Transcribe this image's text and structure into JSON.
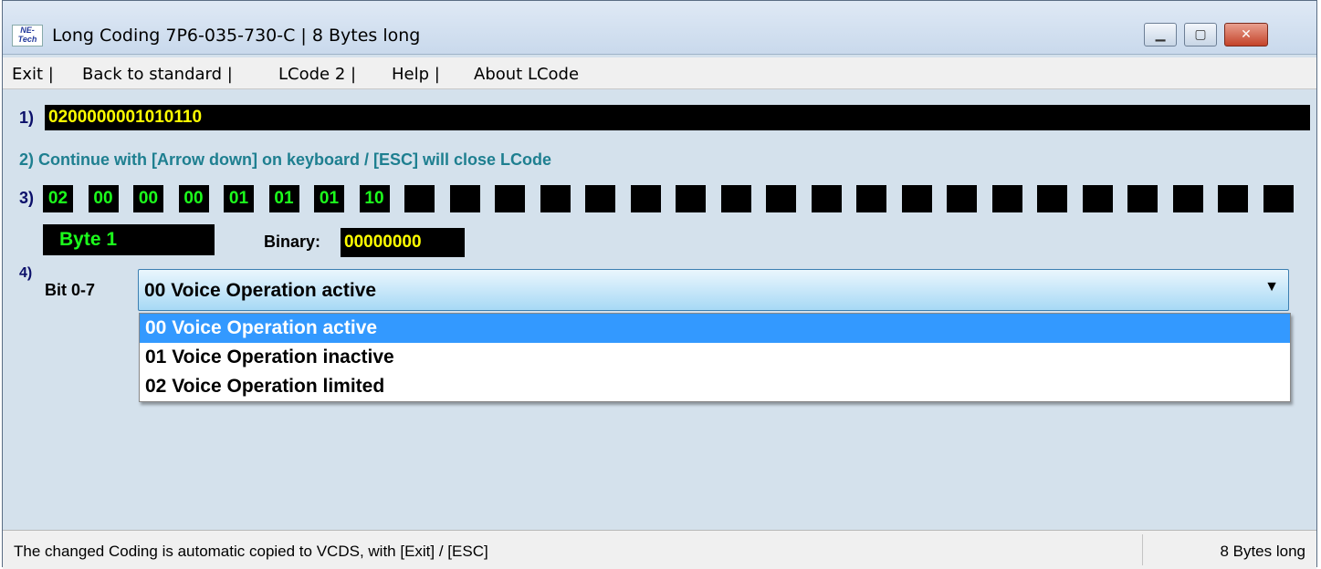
{
  "window": {
    "title": "Long Coding  7P6-035-730-C | 8 Bytes long",
    "icon_text_1": "NE-",
    "icon_text_2": "Tech"
  },
  "menu": [
    "Exit |",
    "Back to standard |",
    "LCode 2 |",
    "Help |",
    "About LCode"
  ],
  "steps": {
    "s1": "1)",
    "s2": "2) Continue with [Arrow down] on keyboard / [ESC] will close LCode",
    "s3": "3)",
    "s4": "4)"
  },
  "coding_value": "0200000001010110",
  "bytes": [
    "02",
    "00",
    "00",
    "00",
    "01",
    "01",
    "01",
    "10",
    "",
    "",
    "",
    "",
    "",
    "",
    "",
    "",
    "",
    "",
    "",
    "",
    "",
    "",
    "",
    "",
    "",
    "",
    "",
    ""
  ],
  "byte_label": "Byte 1",
  "binary": {
    "label": "Binary:",
    "value": "00000000"
  },
  "bit": {
    "label": "Bit 0-7",
    "selected": "00 Voice Operation active",
    "options": [
      "00 Voice Operation active",
      "01 Voice Operation inactive",
      "02 Voice Operation limited"
    ]
  },
  "status": {
    "text": "The changed Coding is automatic copied to VCDS, with [Exit] / [ESC]",
    "right": "8 Bytes long"
  },
  "colors": {
    "field_bg": "#000000",
    "coding_fg": "#ffff00",
    "bytes_fg": "#1cff1c",
    "highlight": "#3399ff",
    "step_teal": "#1e7f90"
  }
}
